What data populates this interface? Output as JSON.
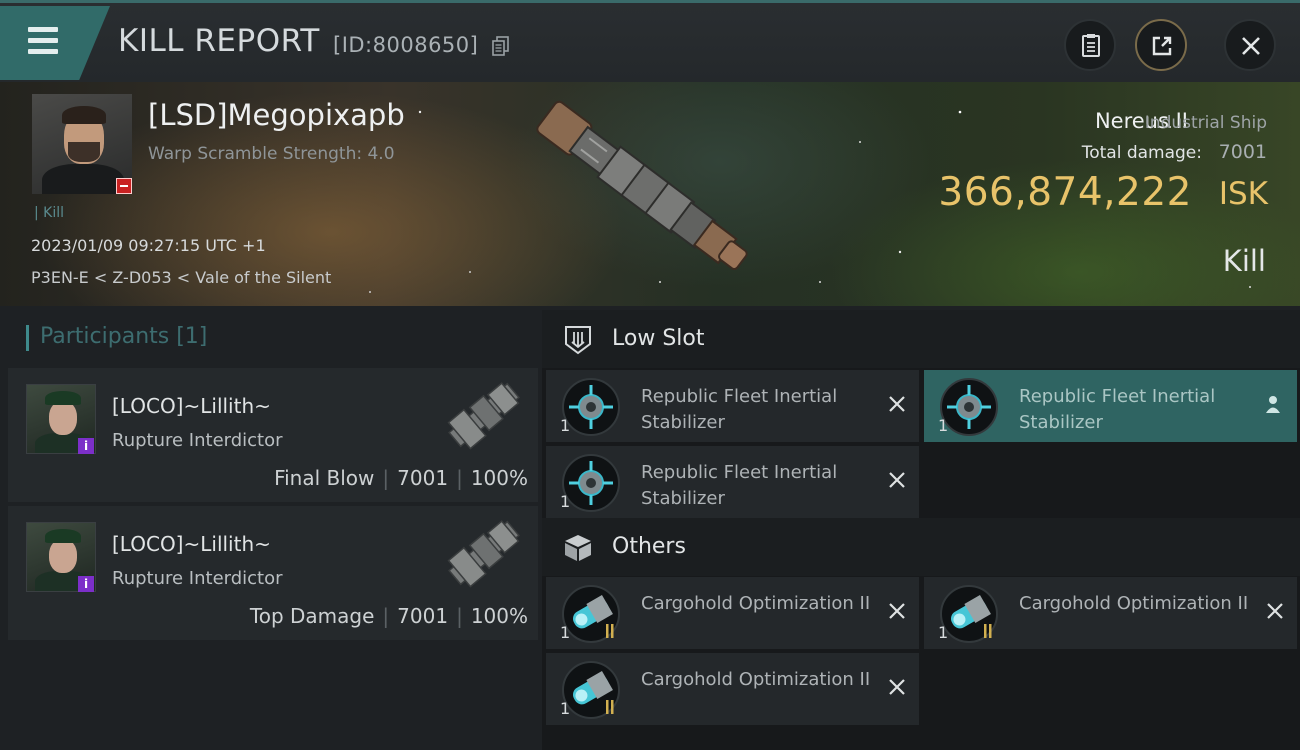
{
  "header": {
    "title": "KILL REPORT",
    "id": "[ID:8008650]",
    "buttons": [
      "clipboard-icon",
      "share-icon",
      "close-icon"
    ]
  },
  "victim": {
    "name": "[LSD]Megopixapb",
    "warp_scramble": "Warp Scramble Strength: 4.0",
    "kill_tag": "Kill",
    "timestamp": "2023/01/09 09:27:15 UTC +1",
    "location": "P3EN-E < Z-D053 < Vale of the Silent",
    "ship_name": "Nereus II",
    "ship_class": "Industrial Ship",
    "total_damage_label": "Total damage:",
    "total_damage": "7001",
    "isk_value": "366,874,222",
    "isk_unit": "ISK",
    "result": "Kill"
  },
  "participants": {
    "header": "Participants [1]",
    "rows": [
      {
        "name": "[LOCO]~Lillith~",
        "ship": "Rupture Interdictor",
        "role": "Final Blow",
        "damage": "7001",
        "percent": "100%"
      },
      {
        "name": "[LOCO]~Lillith~",
        "ship": "Rupture Interdictor",
        "role": "Top Damage",
        "damage": "7001",
        "percent": "100%"
      }
    ]
  },
  "fitting": {
    "low_slot": {
      "label": "Low Slot",
      "items": [
        {
          "qty": "1",
          "name": "Republic Fleet Inertial Stabilizer",
          "state": "destroyed"
        },
        {
          "qty": "1",
          "name": "Republic Fleet Inertial Stabilizer",
          "state": "dropped"
        },
        {
          "qty": "1",
          "name": "Republic Fleet Inertial Stabilizer",
          "state": "destroyed"
        }
      ]
    },
    "others": {
      "label": "Others",
      "items": [
        {
          "qty": "1",
          "name": "Cargohold Optimization II",
          "state": "destroyed"
        },
        {
          "qty": "1",
          "name": "Cargohold Optimization II",
          "state": "destroyed"
        },
        {
          "qty": "1",
          "name": "Cargohold Optimization II",
          "state": "destroyed"
        }
      ]
    }
  },
  "colors": {
    "accent": "#316b69",
    "isk": "#e8c36a",
    "selected": "#2f6462",
    "alliance_badge": "#7c2fc9",
    "danger_badge": "#c92222"
  }
}
